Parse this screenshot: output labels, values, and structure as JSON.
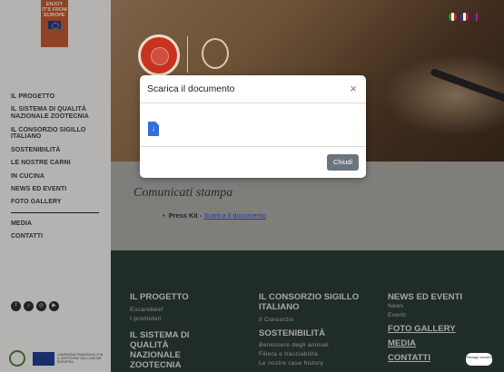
{
  "logo": {
    "line1": "ENJOY",
    "line2": "IT'S FROM",
    "line3": "EUROPE"
  },
  "nav": {
    "items": [
      {
        "label": "IL PROGETTO"
      },
      {
        "label": "IL SISTEMA DI QUALITÀ NAZIONALE ZOOTECNIA"
      },
      {
        "label": "IL CONSORZIO SIGILLO ITALIANO"
      },
      {
        "label": "SOSTENIBILITÀ"
      },
      {
        "label": "LE NOSTRE CARNI"
      },
      {
        "label": "IN CUCINA"
      },
      {
        "label": "NEWS ED EVENTI"
      },
      {
        "label": "FOTO GALLERY"
      }
    ],
    "extra": [
      {
        "label": "MEDIA"
      },
      {
        "label": "CONTATTI"
      }
    ]
  },
  "languages": [
    "it",
    "fr",
    "en"
  ],
  "content": {
    "title": "Comunicati stampa",
    "press_prefix": "Press Kit - ",
    "press_link": "Scarica il documento"
  },
  "footer": {
    "col1": {
      "heading": "IL PROGETTO",
      "links": [
        "Eucarebeef",
        "I promotori"
      ],
      "heading2": "IL SISTEMA DI QUALITÀ NAZIONALE ZOOTECNIA"
    },
    "col2": {
      "heading": "IL CONSORZIO SIGILLO ITALIANO",
      "links": [
        "Il Consorzio"
      ],
      "heading2": "SOSTENIBILITÀ",
      "links2": [
        "Benessere degli animali",
        "Filiera e tracciabilità",
        "Le nostre case history"
      ]
    },
    "col3": {
      "heading": "NEWS ED EVENTI",
      "links": [
        "News",
        "Eventi"
      ],
      "extra": [
        "FOTO GALLERY",
        "MEDIA",
        "CONTATTI"
      ]
    },
    "manage_consent": "Manage consent"
  },
  "footer_logo_text": "CAMPAGNA FINANZIATA CON IL SOSTEGNO DELL'UNIONE EUROPEA",
  "modal": {
    "title": "Scarica il documento",
    "close_symbol": "×",
    "button_label": "Chiudi"
  },
  "colors": {
    "modal_button": "#6c757d",
    "link": "#1c3f9c",
    "footer_bg": "#202c28",
    "doc_icon": "#2f6fde"
  }
}
